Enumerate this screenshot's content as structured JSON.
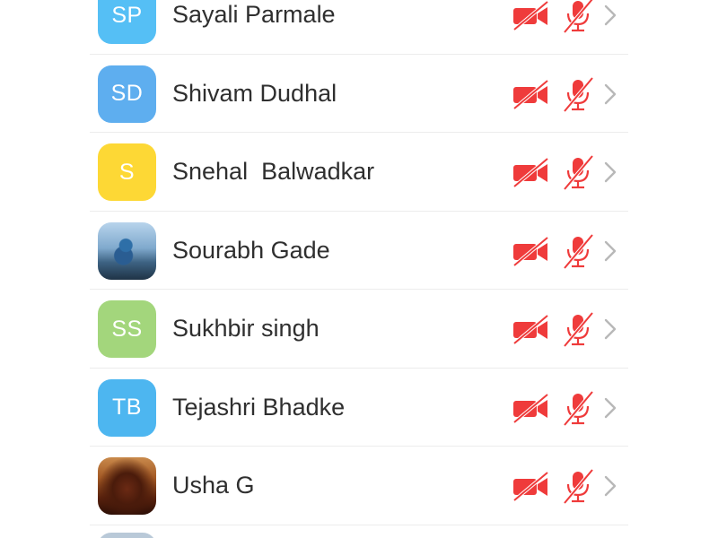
{
  "participants": [
    {
      "name": "Sayali Parmale",
      "avatar": {
        "type": "initials",
        "text": "SP",
        "color": "#55bff5"
      }
    },
    {
      "name": "Shivam Dudhal",
      "avatar": {
        "type": "initials",
        "text": "SD",
        "color": "#5eaeef"
      }
    },
    {
      "name": "Snehal  Balwadkar",
      "avatar": {
        "type": "initials",
        "text": "S",
        "color": "#fdd835"
      }
    },
    {
      "name": "Sourabh Gade",
      "avatar": {
        "type": "photo"
      }
    },
    {
      "name": "Sukhbir singh",
      "avatar": {
        "type": "initials",
        "text": "SS",
        "color": "#a3d67c"
      }
    },
    {
      "name": "Tejashri Bhadke",
      "avatar": {
        "type": "initials",
        "text": "TB",
        "color": "#4db6f0"
      }
    },
    {
      "name": "Usha G",
      "avatar": {
        "type": "photo"
      }
    }
  ],
  "status_icons": {
    "video": "video-off-icon",
    "audio": "mic-off-icon",
    "chevron": "chevron-right-icon",
    "muted_color": "#ef3b3b",
    "chevron_color": "#b8b8b8"
  }
}
